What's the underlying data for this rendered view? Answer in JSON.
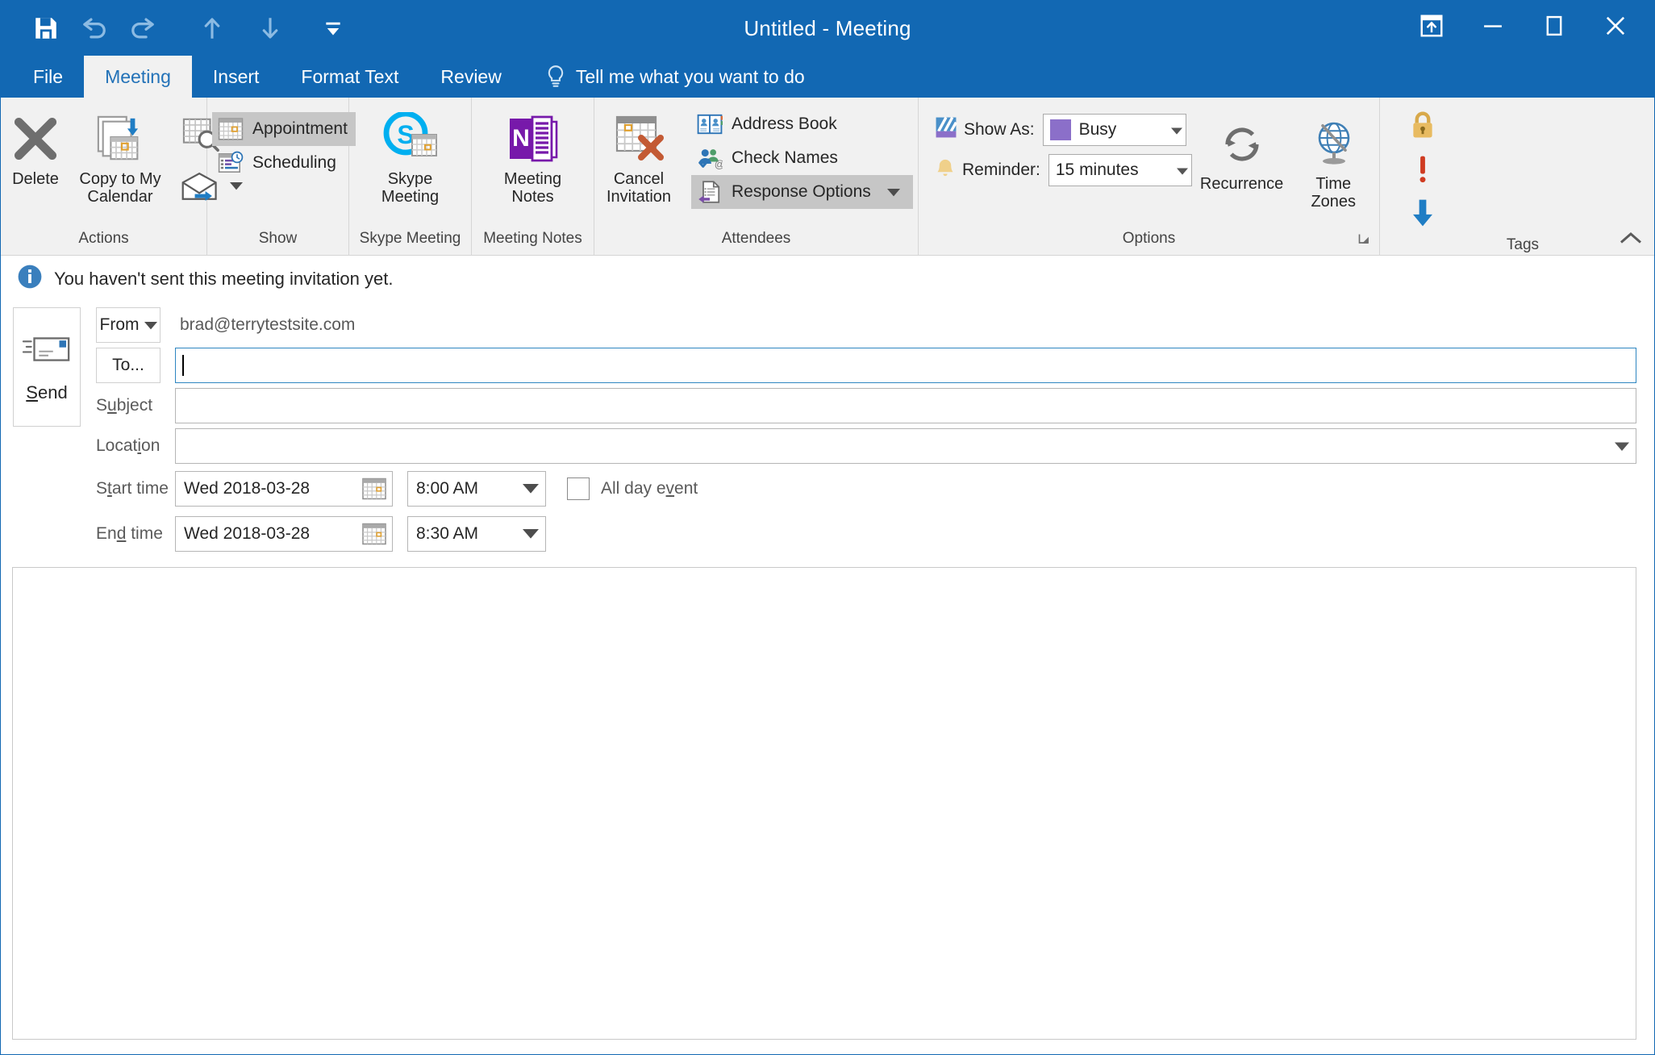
{
  "titlebar": {
    "title": "Untitled  -  Meeting",
    "qat": [
      {
        "name": "save-icon",
        "label": "Save"
      },
      {
        "name": "undo-icon",
        "label": "Undo"
      },
      {
        "name": "redo-icon",
        "label": "Redo"
      },
      {
        "name": "previous-item-icon",
        "label": "Previous Item"
      },
      {
        "name": "next-item-icon",
        "label": "Next Item"
      },
      {
        "name": "customize-qat-icon",
        "label": "Customize Quick Access Toolbar"
      }
    ],
    "window_controls": [
      {
        "name": "ribbon-display-options-icon",
        "label": "Ribbon Display Options"
      },
      {
        "name": "minimize-icon",
        "label": "Minimize"
      },
      {
        "name": "maximize-icon",
        "label": "Maximize"
      },
      {
        "name": "close-icon",
        "label": "Close"
      }
    ]
  },
  "tabs": [
    {
      "label": "File",
      "active": false
    },
    {
      "label": "Meeting",
      "active": true
    },
    {
      "label": "Insert",
      "active": false
    },
    {
      "label": "Format Text",
      "active": false
    },
    {
      "label": "Review",
      "active": false
    }
  ],
  "tellme": {
    "label": "Tell me what you want to do",
    "icon": "lightbulb-icon"
  },
  "ribbon": {
    "groups": [
      {
        "label": "Actions",
        "big": [
          {
            "label": "Delete",
            "icon": "delete-x-icon"
          },
          {
            "label": "Copy to My\nCalendar",
            "icon": "copy-to-calendar-icon"
          }
        ],
        "small": [
          {
            "label": "",
            "icon": "calendar-search-icon"
          },
          {
            "label": "",
            "icon": "forward-envelope-icon",
            "has_dropdown": true
          }
        ]
      },
      {
        "label": "Show",
        "small": [
          {
            "label": "Appointment",
            "icon": "appointment-icon",
            "selected": true
          },
          {
            "label": "Scheduling",
            "icon": "scheduling-icon",
            "selected": false
          }
        ]
      },
      {
        "label": "Skype Meeting",
        "big": [
          {
            "label": "Skype\nMeeting",
            "icon": "skype-meeting-icon"
          }
        ]
      },
      {
        "label": "Meeting Notes",
        "big": [
          {
            "label": "Meeting\nNotes",
            "icon": "onenote-icon"
          }
        ]
      },
      {
        "label": "Attendees",
        "big": [
          {
            "label": "Cancel\nInvitation",
            "icon": "cancel-invitation-icon"
          }
        ],
        "small": [
          {
            "label": "Address Book",
            "icon": "address-book-icon"
          },
          {
            "label": "Check Names",
            "icon": "check-names-icon"
          },
          {
            "label": "Response Options",
            "icon": "response-options-icon",
            "has_dropdown": true,
            "hover": true
          }
        ]
      },
      {
        "label": "Options",
        "has_dialog_launcher": true,
        "show_as": {
          "label": "Show As:",
          "value": "Busy",
          "swatch_color": "#8b6fc9",
          "icon": "show-as-icon"
        },
        "reminder": {
          "label": "Reminder:",
          "value": "15 minutes",
          "icon": "reminder-bell-icon"
        },
        "big": [
          {
            "label": "Recurrence",
            "icon": "recurrence-icon"
          },
          {
            "label": "Time\nZones",
            "icon": "time-zones-globe-icon"
          }
        ]
      },
      {
        "label": "Tags",
        "tags": [
          {
            "name": "private-lock-icon",
            "label": "Private"
          },
          {
            "name": "high-importance-icon",
            "label": "High Importance"
          },
          {
            "name": "low-importance-icon",
            "label": "Low Importance"
          }
        ]
      }
    ],
    "collapse_label": "Collapse the Ribbon"
  },
  "infobar": {
    "icon": "info-icon",
    "message": "You haven't sent this meeting invitation yet."
  },
  "form": {
    "send_button": {
      "label": "Send",
      "icon": "send-envelope-icon"
    },
    "from": {
      "button_label": "From",
      "value": "brad@terrytestsite.com"
    },
    "to": {
      "button_label": "To...",
      "value": "",
      "focused": true
    },
    "subject": {
      "label": "Subject",
      "value": ""
    },
    "location": {
      "label": "Location",
      "value": ""
    },
    "start_time": {
      "label": "Start time",
      "date": "Wed 2018-03-28",
      "time": "8:00 AM"
    },
    "end_time": {
      "label": "End time",
      "date": "Wed 2018-03-28",
      "time": "8:30 AM"
    },
    "all_day": {
      "label": "All day event",
      "checked": false
    }
  },
  "body": {
    "value": ""
  }
}
